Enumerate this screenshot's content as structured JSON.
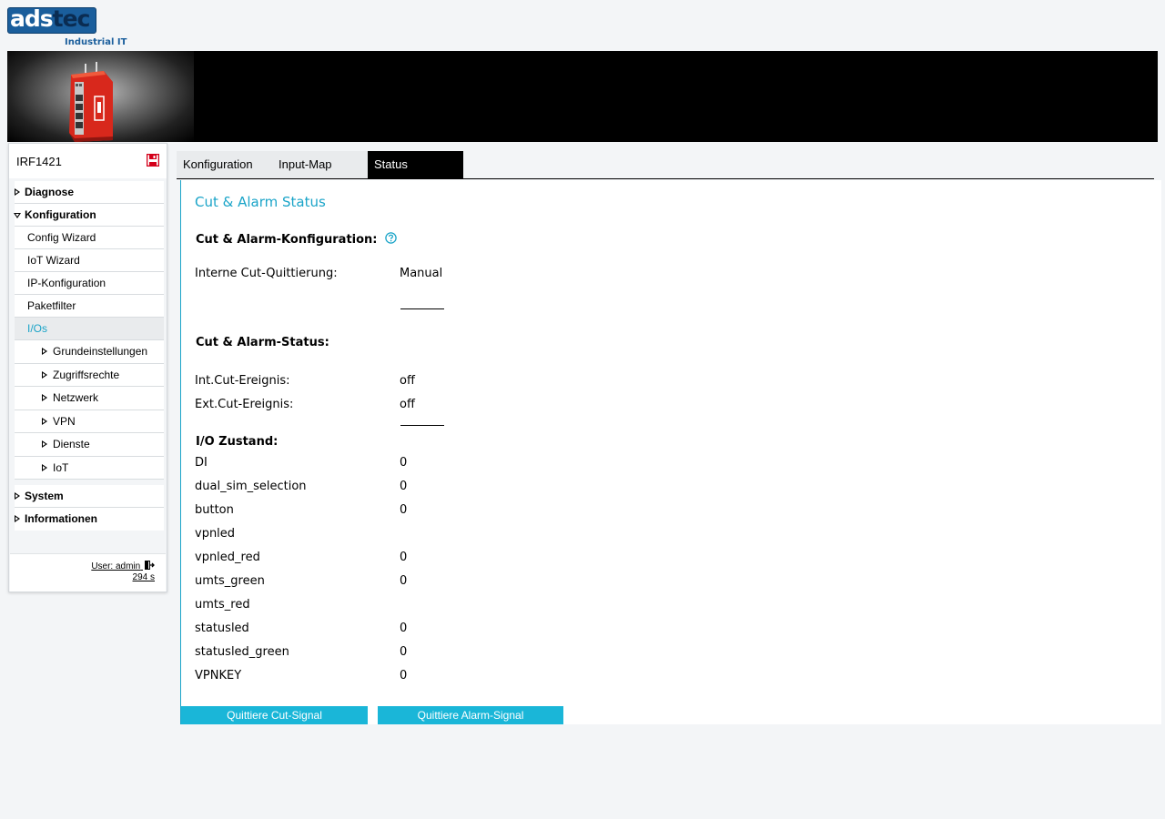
{
  "logo": {
    "brand_left": "ads",
    "brand_right": "tec",
    "tagline": "Industrial IT"
  },
  "sidebar": {
    "device_name": "IRF1421",
    "items": [
      {
        "label": "Diagnose"
      },
      {
        "label": "Konfiguration"
      },
      {
        "label": "Config Wizard"
      },
      {
        "label": "IoT Wizard"
      },
      {
        "label": "IP-Konfiguration"
      },
      {
        "label": "Paketfilter"
      },
      {
        "label": "I/Os"
      },
      {
        "label": "Grundeinstellungen"
      },
      {
        "label": "Zugriffsrechte"
      },
      {
        "label": "Netzwerk"
      },
      {
        "label": "VPN"
      },
      {
        "label": "Dienste"
      },
      {
        "label": "IoT"
      },
      {
        "label": "System"
      },
      {
        "label": "Informationen"
      }
    ],
    "user": "User: admin",
    "session": "294 s"
  },
  "tabs": [
    {
      "label": "Konfiguration"
    },
    {
      "label": "Input-Map"
    },
    {
      "label": "Status"
    }
  ],
  "content": {
    "title": "Cut & Alarm Status",
    "config_heading": "Cut & Alarm-Konfiguration:",
    "internal_ack_label": "Interne Cut-Quittierung:",
    "internal_ack_value": "Manual",
    "status_heading": "Cut & Alarm-Status:",
    "int_cut_label": "Int.Cut-Ereignis:",
    "int_cut_value": "off",
    "ext_cut_label": "Ext.Cut-Ereignis:",
    "ext_cut_value": "off",
    "io_heading": "I/O Zustand:",
    "io_rows": [
      {
        "name": "DI",
        "value": "0"
      },
      {
        "name": "dual_sim_selection",
        "value": "0"
      },
      {
        "name": "button",
        "value": "0"
      },
      {
        "name": "vpnled",
        "value": ""
      },
      {
        "name": "vpnled_red",
        "value": "0"
      },
      {
        "name": "umts_green",
        "value": "0"
      },
      {
        "name": "umts_red",
        "value": ""
      },
      {
        "name": "statusled",
        "value": "0"
      },
      {
        "name": "statusled_green",
        "value": "0"
      },
      {
        "name": "VPNKEY",
        "value": "0"
      }
    ],
    "ack_cut_button": "Quittiere Cut-Signal",
    "ack_alarm_button": "Quittiere Alarm-Signal"
  },
  "colors": {
    "accent": "#1aa4c8",
    "button": "#1ab6d8",
    "brand": "#1a5e9c"
  }
}
